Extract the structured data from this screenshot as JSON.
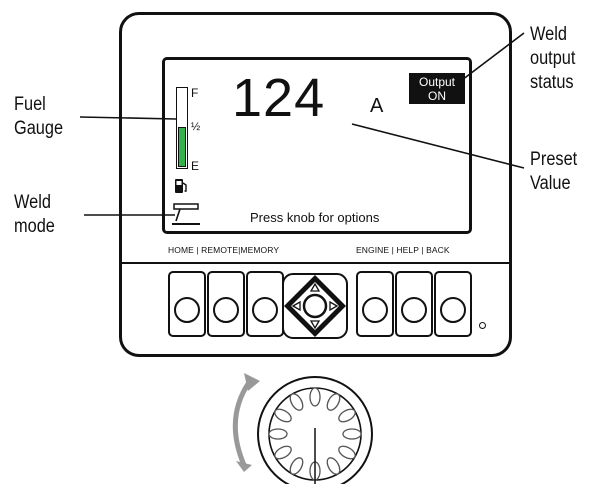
{
  "callouts": {
    "fuel_gauge": [
      "Fuel",
      "Gauge"
    ],
    "weld_mode": [
      "Weld",
      "mode"
    ],
    "weld_output_status": [
      "Weld",
      "output",
      "status"
    ],
    "preset_value": [
      "Preset",
      "Value"
    ]
  },
  "display": {
    "preset_value": "124",
    "unit": "A",
    "output_status": [
      "Output",
      "ON"
    ],
    "prompt": "Press knob for options",
    "fuel_gauge": {
      "full_label": "F",
      "half_label": "½",
      "empty_label": "E",
      "level_fraction": 0.52,
      "fill_color": "#2fb34a",
      "icon": "fuel-pump-icon"
    },
    "weld_mode_icon": "weld-mode-icon"
  },
  "buttons": {
    "label_left": "HOME | REMOTE|MEMORY",
    "label_right": "ENGINE |  HELP  |  BACK",
    "keys": [
      "home",
      "remote",
      "memory",
      "engine",
      "help",
      "back"
    ],
    "nav_icons": [
      "up-arrow-icon",
      "down-arrow-icon",
      "left-arrow-icon",
      "right-arrow-icon"
    ]
  },
  "knob": {
    "icon": "control-knob-icon",
    "rotation_icon": "rotate-arrow-icon"
  }
}
